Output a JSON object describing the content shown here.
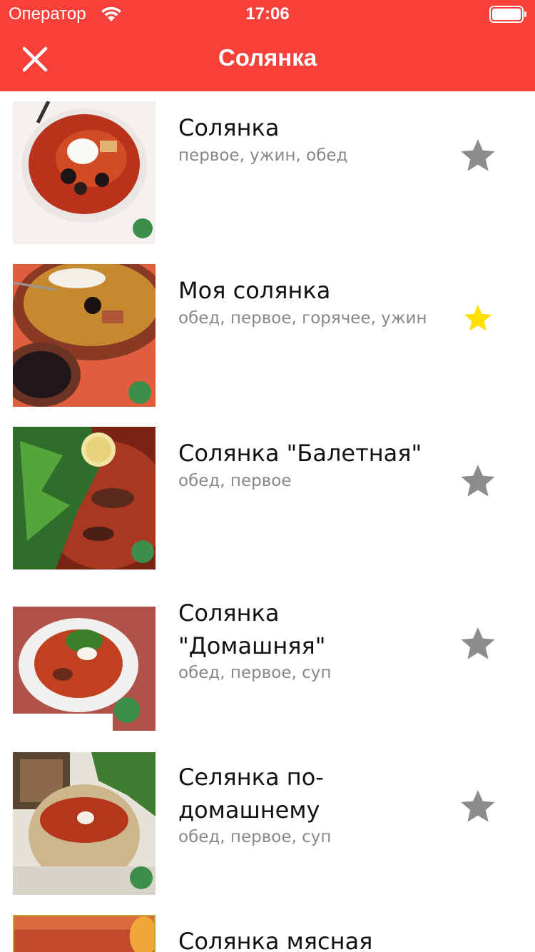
{
  "status_bar": {
    "carrier": "Оператор",
    "time": "17:06"
  },
  "nav": {
    "title": "Солянка"
  },
  "colors": {
    "accent": "#f8403a",
    "star_off": "#8c8c8e",
    "star_on": "#ffe000"
  },
  "recipes": [
    {
      "title": "Солянка",
      "tags": "первое, ужин, обед",
      "favorite": false
    },
    {
      "title": "Моя солянка",
      "tags": "обед, первое, горячее, ужин",
      "favorite": true
    },
    {
      "title": "Солянка \"Балетная\"",
      "tags": "обед, первое",
      "favorite": false
    },
    {
      "title_line1": "Солянка",
      "title_line2": "\"Домашняя\"",
      "tags": "обед, первое, суп",
      "favorite": false
    },
    {
      "title_line1": "Селянка по-",
      "title_line2": "домашнему",
      "tags": "обед, первое, суп",
      "favorite": false
    },
    {
      "title": "Солянка мясная",
      "tags": "",
      "favorite": false
    }
  ],
  "icons": {
    "close": "close-icon",
    "star": "star-icon",
    "wifi": "wifi-icon",
    "battery": "battery-icon"
  }
}
